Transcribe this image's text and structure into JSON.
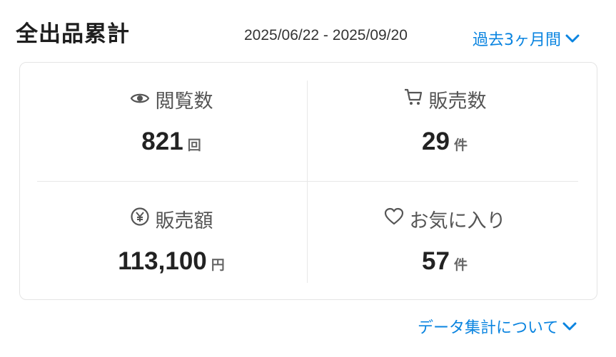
{
  "header": {
    "title": "全出品累計",
    "date_range": "2025/06/22 - 2025/09/20",
    "period_select": "過去3ヶ月間"
  },
  "stats": [
    {
      "label": "閲覧数",
      "icon": "eye-icon",
      "value": "821",
      "unit": "回"
    },
    {
      "label": "販売数",
      "icon": "cart-icon",
      "value": "29",
      "unit": "件"
    },
    {
      "label": "販売額",
      "icon": "yen-circle-icon",
      "value": "113,100",
      "unit": "円"
    },
    {
      "label": "お気に入り",
      "icon": "heart-icon",
      "value": "57",
      "unit": "件"
    }
  ],
  "footer": {
    "link": "データ集計について"
  },
  "colors": {
    "accent": "#0a84e0",
    "text": "#222222",
    "muted": "#555555",
    "border": "#e4e4e4"
  }
}
